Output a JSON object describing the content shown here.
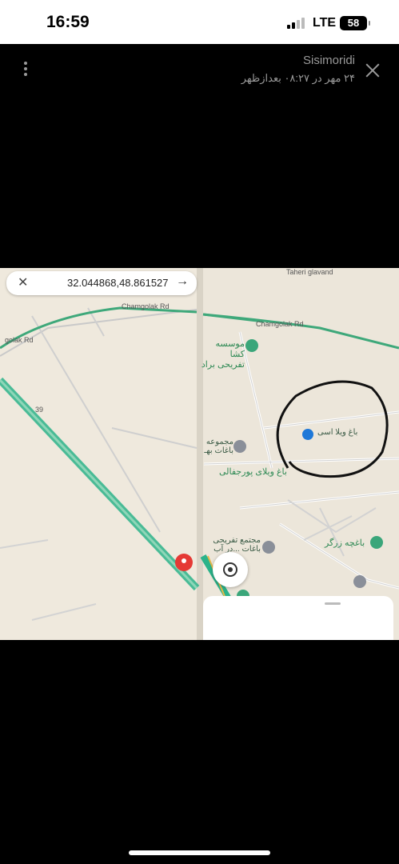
{
  "status_bar": {
    "time": "16:59",
    "network": "LTE",
    "battery": "58"
  },
  "viewer": {
    "sender": "Sisimoridi",
    "sent_time": "۲۴ مهر در ۰۸:۲۷ بعدازظهر"
  },
  "map_left": {
    "coords": "32.044868,48.861527",
    "road_labels": [
      "Chamgolak Rd",
      "golak Rd",
      "39"
    ]
  },
  "map_right": {
    "top_label": "Taheri glavand",
    "road_label": "Chamgolak Rd",
    "places": [
      {
        "name": "موسسه کشا\nتفریحی براد",
        "icon": "park-icon"
      },
      {
        "name": "باغ ویلا اسی",
        "icon": "flag-icon"
      },
      {
        "name": "مجموعه\nباغات بهـ",
        "icon": "pin-icon"
      },
      {
        "name": "باغ ویلای پورجفالی",
        "icon": "none"
      },
      {
        "name": "مجتمع تفریحی\nباغات ...در آب",
        "icon": "pin-icon"
      },
      {
        "name": "باغچه زرگر",
        "icon": "park-icon"
      }
    ]
  },
  "colors": {
    "highway": "#2bb38a",
    "road": "#3ea87a",
    "marker": "#e53935"
  }
}
